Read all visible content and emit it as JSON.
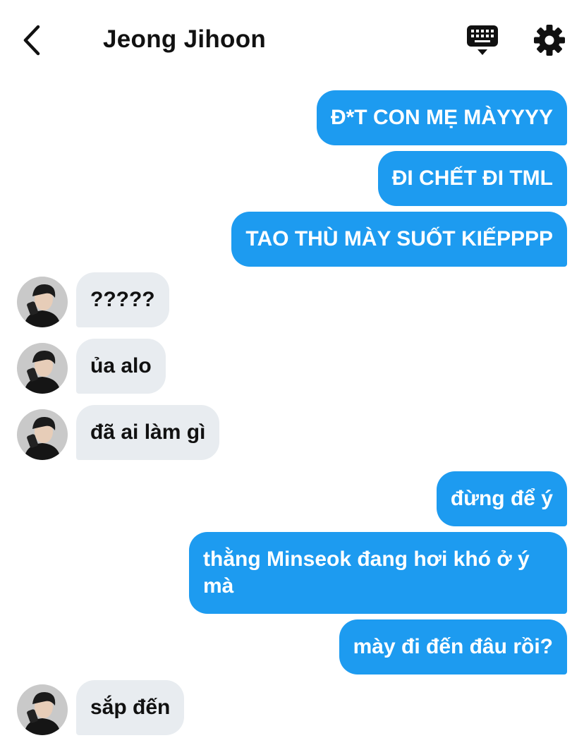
{
  "header": {
    "title": "Jeong Jihoon"
  },
  "messages": [
    {
      "dir": "out",
      "text": "Đ*T CON MẸ MÀYYYY"
    },
    {
      "dir": "out",
      "text": "ĐI CHẾT ĐI TML"
    },
    {
      "dir": "out",
      "text": "TAO THÙ MÀY SUỐT KIẾPPPP"
    },
    {
      "dir": "in",
      "text": "?????"
    },
    {
      "dir": "in",
      "text": "ủa alo"
    },
    {
      "dir": "in",
      "text": "đã ai làm gì"
    },
    {
      "dir": "out",
      "text": "đừng để ý"
    },
    {
      "dir": "out",
      "text": "thằng Minseok đang hơi khó ở ý mà"
    },
    {
      "dir": "out",
      "text": "mày đi đến đâu rồi?"
    },
    {
      "dir": "in",
      "text": "sắp đến"
    }
  ],
  "colors": {
    "outgoing_bubble": "#1d9bf0",
    "incoming_bubble": "#e8ecf0",
    "outgoing_text": "#ffffff",
    "incoming_text": "#111111"
  },
  "icons": {
    "back": "chevron-left-icon",
    "keyboard": "keyboard-icon",
    "settings": "gear-icon"
  }
}
